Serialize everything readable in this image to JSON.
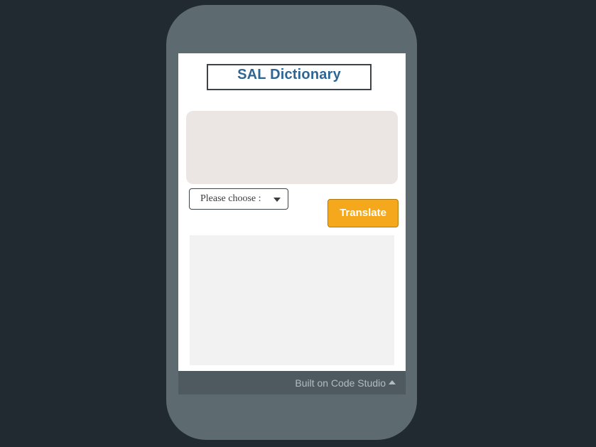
{
  "app": {
    "title": "SAL Dictionary"
  },
  "input": {
    "value": "",
    "placeholder": ""
  },
  "language_select": {
    "selected": "Please choose :"
  },
  "translate_button": {
    "label": "Translate"
  },
  "output": {
    "value": ""
  },
  "footer": {
    "text": "Built on Code Studio",
    "icon": "caret-up-icon"
  },
  "colors": {
    "page_background": "#212a31",
    "phone_frame": "#5d6b71",
    "title_text": "#2f6593",
    "input_background": "#ebe6e3",
    "output_background": "#f2f2f2",
    "button_background": "#f5a81b",
    "footer_background": "#4e5a60"
  }
}
